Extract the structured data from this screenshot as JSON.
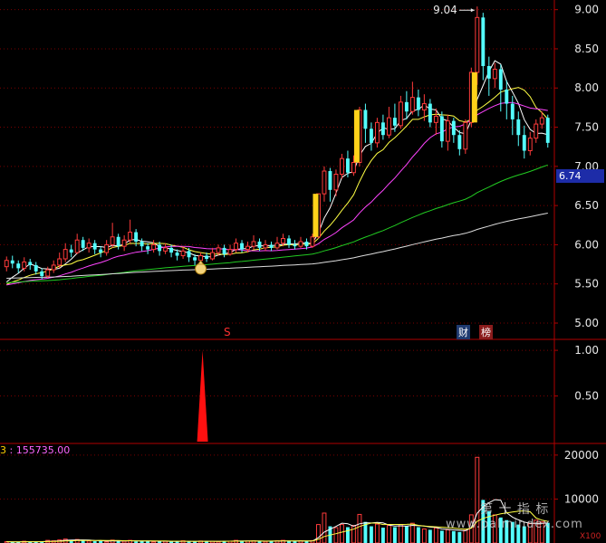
{
  "chart_data": [
    {
      "type": "candlestick",
      "panel": "price",
      "ylim": [
        4.85,
        9.1
      ],
      "yticks": [
        "9.00",
        "8.50",
        "8.00",
        "7.50",
        "7.00",
        "6.50",
        "6.00",
        "5.50",
        "5.00"
      ],
      "annotations": {
        "high_label": "9.04",
        "last_price": "6.74"
      },
      "candles": [
        [
          5.72,
          5.8,
          5.85,
          5.66
        ],
        [
          5.8,
          5.76,
          5.86,
          5.7
        ],
        [
          5.76,
          5.7,
          5.8,
          5.64
        ],
        [
          5.7,
          5.78,
          5.84,
          5.66
        ],
        [
          5.78,
          5.74,
          5.82,
          5.68
        ],
        [
          5.74,
          5.66,
          5.78,
          5.62
        ],
        [
          5.66,
          5.6,
          5.7,
          5.56
        ],
        [
          5.6,
          5.68,
          5.72,
          5.58
        ],
        [
          5.68,
          5.74,
          5.8,
          5.64
        ],
        [
          5.74,
          5.82,
          5.9,
          5.7
        ],
        [
          5.82,
          5.94,
          6.02,
          5.78
        ],
        [
          5.94,
          5.9,
          6.0,
          5.84
        ],
        [
          5.9,
          6.06,
          6.14,
          5.88
        ],
        [
          6.06,
          5.96,
          6.1,
          5.92
        ],
        [
          5.96,
          6.02,
          6.08,
          5.9
        ],
        [
          6.02,
          5.94,
          6.06,
          5.88
        ],
        [
          5.94,
          5.9,
          5.98,
          5.84
        ],
        [
          5.9,
          6.0,
          6.06,
          5.86
        ],
        [
          6.0,
          6.1,
          6.28,
          5.96
        ],
        [
          6.1,
          5.98,
          6.14,
          5.94
        ],
        [
          5.98,
          6.06,
          6.12,
          5.92
        ],
        [
          6.06,
          6.16,
          6.32,
          6.02
        ],
        [
          6.16,
          6.04,
          6.2,
          5.98
        ],
        [
          6.04,
          5.98,
          6.08,
          5.92
        ],
        [
          5.98,
          5.94,
          6.02,
          5.88
        ],
        [
          5.94,
          6.0,
          6.06,
          5.9
        ],
        [
          6.0,
          5.92,
          6.04,
          5.86
        ],
        [
          5.92,
          5.96,
          6.02,
          5.88
        ],
        [
          5.96,
          5.9,
          6.0,
          5.84
        ],
        [
          5.9,
          5.86,
          5.94,
          5.8
        ],
        [
          5.86,
          5.92,
          5.98,
          5.82
        ],
        [
          5.92,
          5.84,
          5.96,
          5.78
        ],
        [
          5.84,
          5.8,
          5.88,
          5.74
        ],
        [
          5.8,
          5.86,
          5.9,
          5.76
        ],
        [
          5.86,
          5.82,
          5.9,
          5.78
        ],
        [
          5.82,
          5.9,
          5.96,
          5.8
        ],
        [
          5.9,
          5.96,
          6.0,
          5.86
        ],
        [
          5.96,
          5.88,
          6.0,
          5.84
        ],
        [
          5.88,
          5.94,
          6.0,
          5.86
        ],
        [
          5.94,
          6.02,
          6.08,
          5.9
        ],
        [
          6.02,
          5.94,
          6.06,
          5.9
        ],
        [
          5.94,
          5.98,
          6.04,
          5.9
        ],
        [
          5.98,
          6.04,
          6.12,
          5.94
        ],
        [
          6.04,
          5.96,
          6.08,
          5.92
        ],
        [
          5.96,
          6.0,
          6.06,
          5.92
        ],
        [
          6.0,
          5.96,
          6.04,
          5.92
        ],
        [
          5.96,
          6.02,
          6.1,
          5.94
        ],
        [
          6.02,
          6.08,
          6.14,
          5.98
        ],
        [
          6.08,
          6.0,
          6.12,
          5.96
        ],
        [
          6.0,
          5.98,
          6.06,
          5.94
        ],
        [
          5.98,
          6.04,
          6.1,
          5.96
        ],
        [
          6.04,
          5.98,
          6.08,
          5.94
        ],
        [
          5.98,
          6.1,
          6.14,
          5.96
        ],
        [
          6.1,
          6.65,
          6.65,
          6.08
        ],
        [
          6.65,
          6.94,
          7.0,
          6.55
        ],
        [
          6.94,
          6.7,
          6.98,
          6.55
        ],
        [
          6.7,
          6.9,
          6.96,
          6.62
        ],
        [
          6.9,
          7.1,
          7.16,
          6.84
        ],
        [
          7.1,
          6.92,
          7.2,
          6.86
        ],
        [
          6.92,
          7.05,
          7.14,
          6.88
        ],
        [
          7.05,
          7.72,
          7.76,
          7.0
        ],
        [
          7.72,
          7.48,
          7.8,
          7.3
        ],
        [
          7.48,
          7.3,
          7.56,
          7.2
        ],
        [
          7.3,
          7.56,
          7.62,
          7.24
        ],
        [
          7.56,
          7.4,
          7.66,
          7.34
        ],
        [
          7.4,
          7.62,
          7.76,
          7.36
        ],
        [
          7.62,
          7.52,
          7.8,
          7.44
        ],
        [
          7.52,
          7.82,
          7.9,
          7.48
        ],
        [
          7.82,
          7.7,
          7.96,
          7.6
        ],
        [
          7.7,
          7.88,
          8.08,
          7.66
        ],
        [
          7.88,
          7.72,
          7.98,
          7.64
        ],
        [
          7.72,
          7.8,
          7.92,
          7.58
        ],
        [
          7.8,
          7.56,
          7.86,
          7.5
        ],
        [
          7.56,
          7.64,
          7.74,
          7.4
        ],
        [
          7.64,
          7.32,
          7.7,
          7.24
        ],
        [
          7.32,
          7.58,
          7.66,
          7.2
        ],
        [
          7.58,
          7.4,
          7.62,
          7.3
        ],
        [
          7.4,
          7.22,
          7.46,
          7.14
        ],
        [
          7.22,
          7.56,
          7.6,
          7.16
        ],
        [
          7.56,
          8.2,
          8.26,
          7.5
        ],
        [
          8.2,
          8.9,
          9.04,
          8.04
        ],
        [
          8.9,
          8.28,
          8.96,
          8.1
        ],
        [
          8.28,
          8.12,
          8.4,
          7.9
        ],
        [
          8.12,
          8.24,
          8.32,
          8.0
        ],
        [
          8.24,
          7.98,
          8.3,
          7.7
        ],
        [
          7.98,
          7.8,
          8.1,
          7.6
        ],
        [
          7.8,
          7.6,
          7.9,
          7.4
        ],
        [
          7.6,
          7.4,
          7.7,
          7.26
        ],
        [
          7.4,
          7.2,
          7.52,
          7.1
        ],
        [
          7.2,
          7.36,
          7.44,
          7.14
        ],
        [
          7.36,
          7.54,
          7.6,
          7.3
        ],
        [
          7.54,
          7.62,
          7.7,
          7.48
        ],
        [
          7.62,
          7.3,
          7.66,
          7.24
        ]
      ],
      "signal_bars": [
        {
          "index": 53,
          "from": 6.1,
          "to": 6.65
        },
        {
          "index": 60,
          "from": 7.05,
          "to": 7.72
        },
        {
          "index": 80,
          "from": 7.56,
          "to": 8.2
        }
      ],
      "moving_averages": [
        {
          "color": "#ffffff",
          "window": 5
        },
        {
          "color": "#ffff44",
          "window": 10
        },
        {
          "color": "#ff44ff",
          "window": 20
        },
        {
          "color": "#22cc22",
          "window": 60
        },
        {
          "color": "#dddddd",
          "window": 120
        }
      ],
      "markers": [
        {
          "label": "S",
          "color": "#ff3030"
        },
        {
          "label": "财",
          "color": "#ffffff"
        },
        {
          "label": "榜",
          "color": "#ffffff"
        }
      ]
    },
    {
      "type": "bar",
      "panel": "signal",
      "ylim": [
        0,
        1.1
      ],
      "yticks": [
        "1.00",
        "0.50"
      ],
      "spike_value": 1.0,
      "color": "#ff1010"
    },
    {
      "type": "bar",
      "panel": "volume",
      "ylim": [
        0,
        21000
      ],
      "yticks": [
        "20000",
        "10000"
      ],
      "title_index": "3",
      "title_value": "155735.00",
      "multiplier_label": "X100",
      "values": [
        300,
        200,
        250,
        400,
        260,
        300,
        350,
        600,
        500,
        700,
        900,
        650,
        800,
        500,
        450,
        400,
        500,
        300,
        650,
        500,
        400,
        600,
        350,
        500,
        420,
        300,
        450,
        380,
        300,
        350,
        500,
        400,
        300,
        450,
        380,
        400,
        350,
        500,
        420,
        600,
        380,
        450,
        500,
        400,
        350,
        420,
        500,
        600,
        450,
        380,
        500,
        420,
        550,
        4200,
        6800,
        3800,
        3500,
        4200,
        3600,
        4000,
        6500,
        4800,
        3800,
        4300,
        3500,
        4000,
        3600,
        4200,
        3800,
        4500,
        3600,
        3200,
        3000,
        3400,
        2800,
        3000,
        2700,
        2500,
        2900,
        6400,
        19500,
        9800,
        7200,
        6400,
        5800,
        5200,
        4800,
        4200,
        3800,
        4400,
        5200,
        4800,
        4600
      ],
      "ma_lines": [
        {
          "color": "#ffffff"
        },
        {
          "color": "#ffff44"
        }
      ]
    }
  ],
  "watermark": {
    "top": "第 十 指 标",
    "bottom": "www.palmindex.com"
  }
}
